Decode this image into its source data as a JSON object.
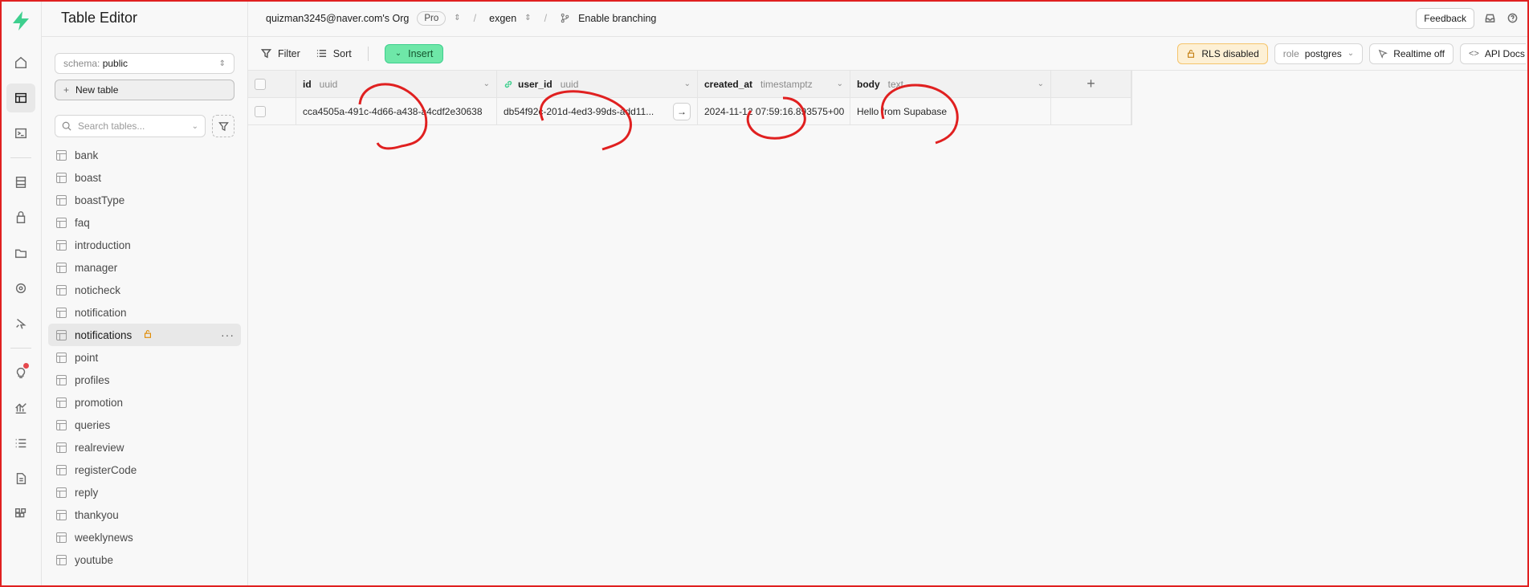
{
  "sidebar": {
    "title": "Table Editor",
    "schema_label": "schema:",
    "schema_value": "public",
    "new_table_label": "New table",
    "search_placeholder": "Search tables...",
    "tables": [
      "bank",
      "boast",
      "boastType",
      "faq",
      "introduction",
      "manager",
      "noticheck",
      "notification",
      "notifications",
      "point",
      "profiles",
      "promotion",
      "queries",
      "realreview",
      "registerCode",
      "reply",
      "thankyou",
      "weeklynews",
      "youtube"
    ],
    "active_table": "notifications"
  },
  "topbar": {
    "org": "quizman3245@naver.com's Org",
    "plan": "Pro",
    "project": "exgen",
    "branching": "Enable branching",
    "feedback": "Feedback"
  },
  "toolbar": {
    "filter": "Filter",
    "sort": "Sort",
    "insert": "Insert",
    "rls": "RLS disabled",
    "role_prefix": "role",
    "role_value": "postgres",
    "realtime": "Realtime off",
    "api_docs": "API Docs"
  },
  "grid": {
    "columns": [
      {
        "name": "id",
        "type": "uuid"
      },
      {
        "name": "user_id",
        "type": "uuid"
      },
      {
        "name": "created_at",
        "type": "timestamptz"
      },
      {
        "name": "body",
        "type": "text"
      }
    ],
    "rows": [
      {
        "id": "cca4505a-491c-4d66-a438-a4cdf2e30638",
        "user_id": "db54f92c-201d-4ed3-99ds-add11...",
        "created_at": "2024-11-12 07:59:16.893575+00",
        "body": "Hello from Supabase"
      }
    ]
  },
  "colors": {
    "accent": "#3ecf8e",
    "annotation": "#e02020",
    "rls_warning": "#f5c46b"
  }
}
